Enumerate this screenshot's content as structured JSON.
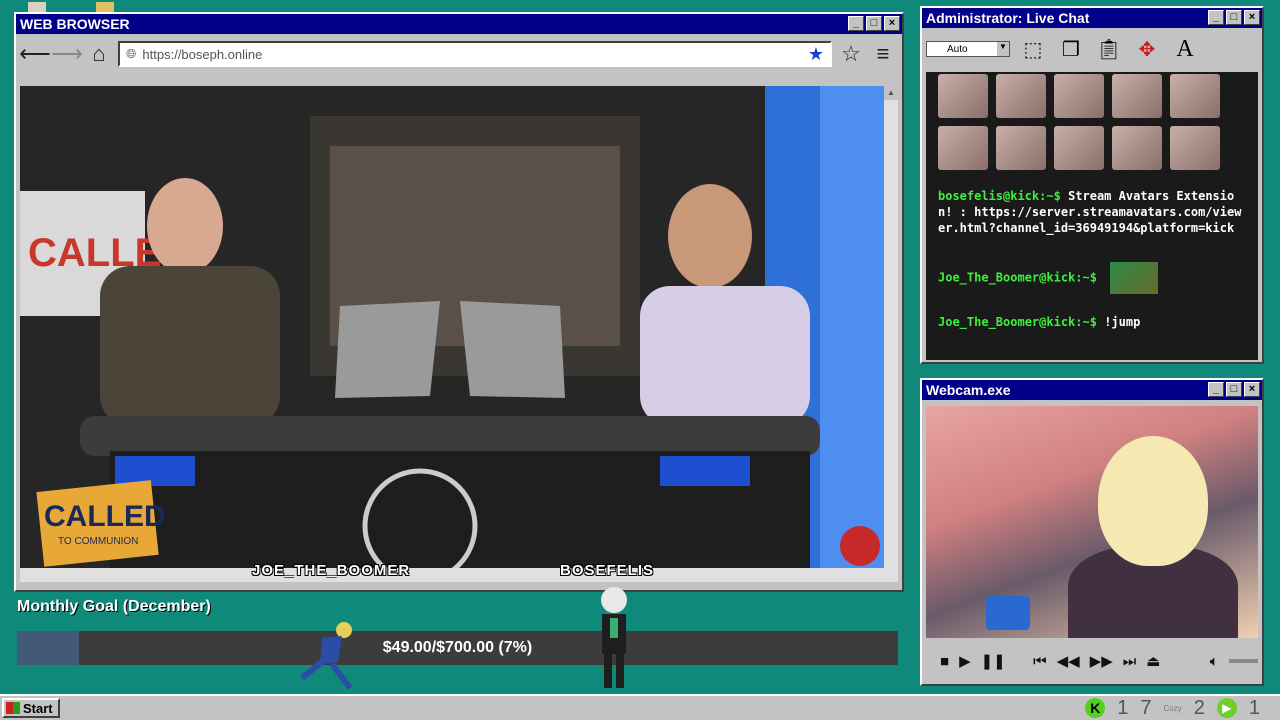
{
  "browser": {
    "title": "WEB BROWSER",
    "url": "https://boseph.online",
    "nametags": [
      "JOE_THE_BOOMER",
      "BOSEFELIS"
    ],
    "video_logo_text": "CALLED",
    "video_logo_sub": "TO COMMUNION"
  },
  "chat": {
    "title": "Administrator: Live Chat",
    "font_select": "Auto",
    "messages": [
      {
        "user": "bosefelis@kick:~$",
        "text": "Stream Avatars Extension! : https://server.streamavatars.com/viewer.html?channel_id=36949194&platform=kick"
      },
      {
        "user": "Joe_The_Boomer@kick:~$",
        "text": ""
      },
      {
        "user": "Joe_The_Boomer@kick:~$",
        "text": "!jump"
      }
    ]
  },
  "webcam": {
    "title": "Webcam.exe"
  },
  "goal": {
    "title": "Monthly Goal (December)",
    "text": "$49.00/$700.00 (7%)",
    "progress": 0.07
  },
  "taskbar": {
    "start_label": "Start",
    "tray_numbers": [
      "1",
      "7",
      "2",
      "1"
    ],
    "cozy_label": "Cozy",
    "kick_label": "K"
  },
  "colors": {
    "desktop": "#0f8a7a",
    "titlebar": "#000088",
    "chat_user": "#3df03d",
    "goal_fill": "#425a78"
  }
}
